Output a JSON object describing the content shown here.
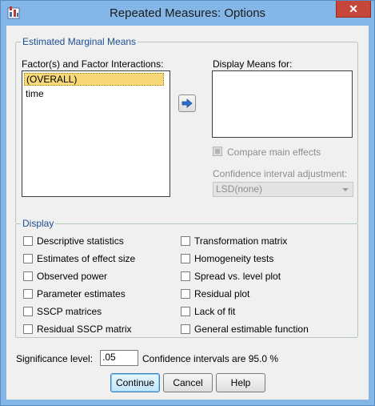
{
  "window": {
    "title": "Repeated Measures: Options",
    "close_glyph": "✕"
  },
  "emm": {
    "legend": "Estimated Marginal Means",
    "factors_label": "Factor(s) and Factor Interactions:",
    "factors": [
      "(OVERALL)",
      "time"
    ],
    "display_means_label": "Display Means for:",
    "compare_main_effects": "Compare main effects",
    "ci_adjustment_label": "Confidence interval adjustment:",
    "ci_adjustment_value": "LSD(none)"
  },
  "display": {
    "legend": "Display",
    "left_options": [
      "Descriptive statistics",
      "Estimates of effect size",
      "Observed power",
      "Parameter estimates",
      "SSCP matrices",
      "Residual SSCP matrix"
    ],
    "right_options": [
      "Transformation matrix",
      "Homogeneity tests",
      "Spread vs. level plot",
      "Residual plot",
      "Lack of fit",
      "General estimable function"
    ]
  },
  "significance": {
    "label": "Significance level:",
    "value": ".05",
    "ci_text": "Confidence intervals are 95.0 %"
  },
  "buttons": {
    "continue": "Continue",
    "cancel": "Cancel",
    "help": "Help"
  },
  "colors": {
    "titlebar": "#85b6e8",
    "close": "#c7463a",
    "legend_text": "#1d4f91",
    "selection": "#f7d97a",
    "arrow_icon": "#2e6fc7"
  }
}
